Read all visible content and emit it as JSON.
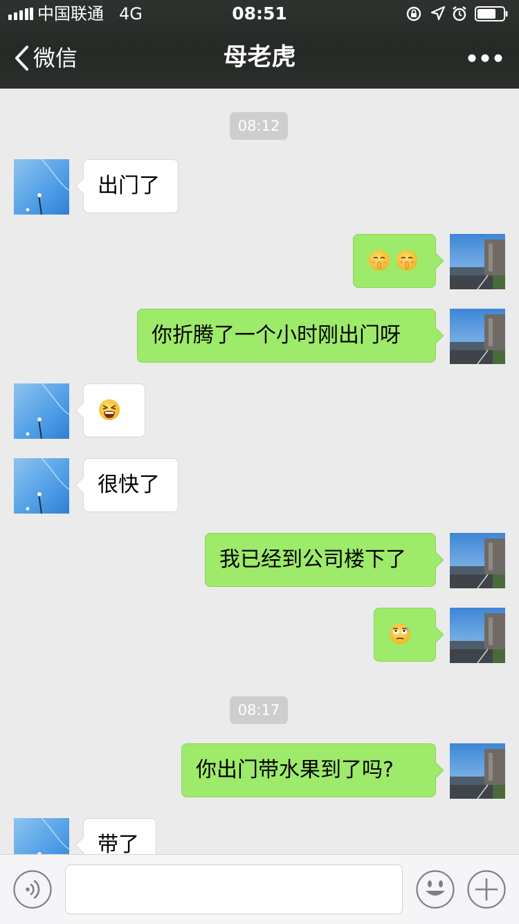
{
  "status_bar": {
    "carrier": "中国联通",
    "network": "4G",
    "time": "08:51"
  },
  "nav": {
    "back_label": "微信",
    "title": "母老虎"
  },
  "messages": {
    "t1": "08:12",
    "m1": "出门了",
    "m3": "你折腾了一个小时刚出门呀",
    "m5": "很快了",
    "m6": "我已经到公司楼下了",
    "t2": "08:17",
    "m8": "你出门带水果到了吗?",
    "m9": "带了"
  },
  "emoji_names": {
    "m2": [
      "shushing-face-emoji",
      "shushing-face-emoji"
    ],
    "m4": "tired-crying-face-emoji",
    "m7": "sweat-eye-roll-face-emoji"
  },
  "colors": {
    "header_bg": "#2b2e2b",
    "chat_bg": "#ebebeb",
    "outgoing_bubble": "#9eea6a",
    "incoming_bubble": "#ffffff",
    "time_pill": "#cecece"
  },
  "icons": {
    "back": "chevron-left-icon",
    "more": "more-dots-icon",
    "voice": "voice-icon",
    "emoji": "emoji-face-icon",
    "plus": "plus-icon"
  }
}
